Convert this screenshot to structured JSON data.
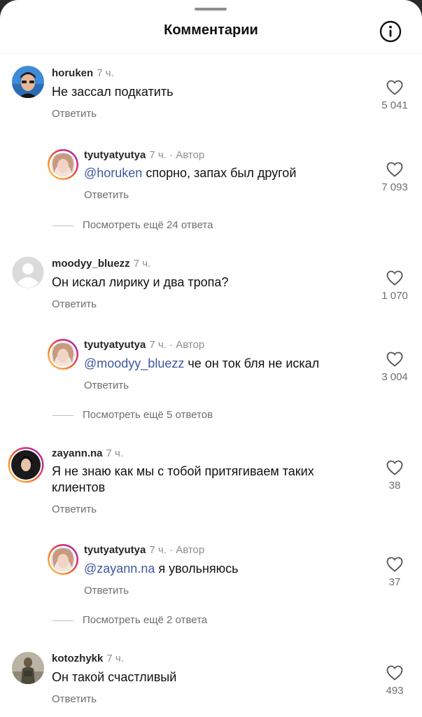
{
  "header": {
    "title": "Комментарии"
  },
  "comments": [
    {
      "username": "horuken",
      "time": "7 ч.",
      "text": "Не зассал подкатить",
      "reply_label": "Ответить",
      "likes": "5 041",
      "reply": {
        "username": "tyutyatyutya",
        "time": "7 ч.",
        "author_label": "· Автор",
        "mention": "@horuken",
        "text": " спорно, запах был другой",
        "reply_label": "Ответить",
        "likes": "7 093"
      },
      "view_more": "Посмотреть ещё 24 ответа"
    },
    {
      "username": "moodyy_bluezz",
      "time": "7 ч.",
      "text": "Он искал лирику и два тропа?",
      "reply_label": "Ответить",
      "likes": "1 070",
      "reply": {
        "username": "tyutyatyutya",
        "time": "7 ч.",
        "author_label": "· Автор",
        "mention": "@moodyy_bluezz",
        "text": " че он ток бля не искал",
        "reply_label": "Ответить",
        "likes": "3 004"
      },
      "view_more": "Посмотреть ещё 5 ответов"
    },
    {
      "username": "zayann.na",
      "time": "7 ч.",
      "text": "Я не знаю как мы с тобой притягиваем таких клиентов",
      "reply_label": "Ответить",
      "likes": "38",
      "reply": {
        "username": "tyutyatyutya",
        "time": "7 ч.",
        "author_label": "· Автор",
        "mention": "@zayann.na",
        "text": " я увольняюсь",
        "reply_label": "Ответить",
        "likes": "37"
      },
      "view_more": "Посмотреть ещё 2 ответа"
    },
    {
      "username": "kotozhykk",
      "time": "7 ч.",
      "text": "Он такой счастливый",
      "reply_label": "Ответить",
      "likes": "493"
    }
  ],
  "icons": {
    "info": "info-circle-icon",
    "like": "heart-outline-icon"
  },
  "colors": {
    "mention": "#3d59a1",
    "muted": "#8e8e8e",
    "story_ring": [
      "#feda75",
      "#fa7e1e",
      "#d62976",
      "#962fbf"
    ]
  }
}
